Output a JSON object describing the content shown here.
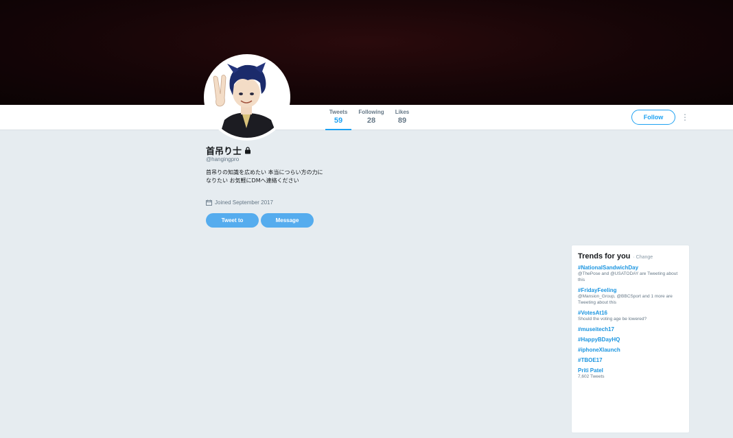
{
  "profile": {
    "name": "首吊り士",
    "handle": "@hangingpro",
    "bio": "首吊りの知識を広めたい 本当につらい方の力になりたい お気軽にDMへ連絡ください",
    "joined": "Joined September 2017"
  },
  "stats": {
    "tweets_label": "Tweets",
    "tweets_value": "59",
    "following_label": "Following",
    "following_value": "28",
    "likes_label": "Likes",
    "likes_value": "89"
  },
  "actions": {
    "follow_label": "Follow",
    "more_label": "⋮",
    "tweet_to_label": "Tweet to",
    "message_label": "Message"
  },
  "trends": {
    "title": "Trends for you",
    "change_label": "· Change",
    "items": [
      {
        "name": "#NationalSandwichDay",
        "desc": "@ThePose and @USATODAY are Tweeting about this"
      },
      {
        "name": "#FridayFeeling",
        "desc": "@Mansion_Group, @BBCSport and 1 more are Tweeting about this"
      },
      {
        "name": "#VotesAt16",
        "desc": "Should the voting age be lowered?"
      },
      {
        "name": "#museitech17",
        "desc": ""
      },
      {
        "name": "#HappyBDayHQ",
        "desc": ""
      },
      {
        "name": "#iphoneXlaunch",
        "desc": ""
      },
      {
        "name": "#TBOE17",
        "desc": ""
      },
      {
        "name": "Priti Patel",
        "desc": "7,602 Tweets"
      }
    ]
  },
  "colors": {
    "accent": "#1da1f2",
    "background": "#e6ecf0",
    "banner": "#160507"
  },
  "icons": {
    "lock": "lock-icon",
    "calendar": "calendar-icon",
    "more": "more-icon"
  }
}
